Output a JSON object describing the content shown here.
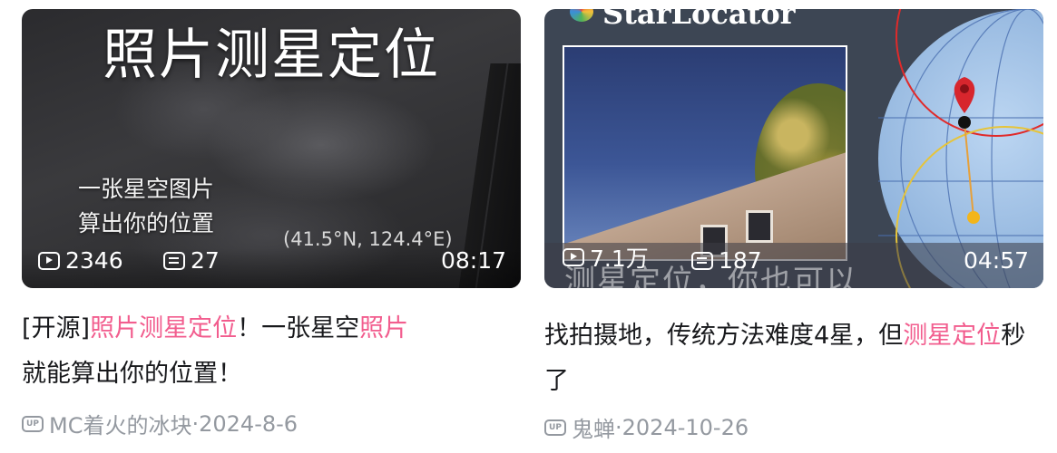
{
  "cards": [
    {
      "thumb_title": "照片测星定位",
      "thumb_sub1": "一张星空图片",
      "thumb_sub2": "算出你的位置",
      "thumb_coords": "(41.5°N, 124.4°E)",
      "views": "2346",
      "danmaku": "27",
      "duration": "08:17",
      "title_parts": [
        "[开源]",
        "照片测星定位",
        "！一张星空",
        "照片",
        "就能算出你的位置！"
      ],
      "up_badge": "UP",
      "author": "MC着火的冰块",
      "date": "2024-8-6"
    },
    {
      "brand": "StarLocator",
      "thumb_ghost": "测星定位，你也可以",
      "views": "7.1万",
      "danmaku": "187",
      "duration": "04:57",
      "title_parts": [
        "找拍摄地，传统方法难度4星，但",
        "测星定位",
        "秒了"
      ],
      "up_badge": "UP",
      "author": "鬼蝉",
      "date": "2024-10-26"
    }
  ],
  "meta_separator": " · ",
  "colors": {
    "highlight": "#f25d8e",
    "meta": "#9499a0"
  }
}
